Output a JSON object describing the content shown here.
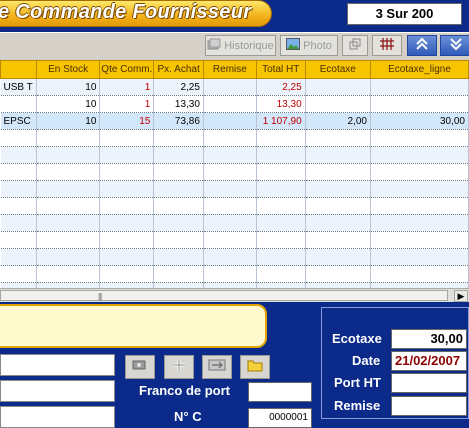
{
  "window": {
    "title": "e Commande Fournisseur",
    "record_counter": "3 Sur 200"
  },
  "toolbar": {
    "historique_label": "Historique",
    "photo_label": "Photo"
  },
  "colors": {
    "accent_gold": "#f2b11b",
    "navy_background": "#0b2a8a",
    "header_yellow": "#f7c400",
    "negative_red": "#c00000"
  },
  "grid": {
    "columns": [
      "",
      "En Stock",
      "Qte Comm.",
      "Px. Achat",
      "Remise",
      "Total HT",
      "Ecotaxe",
      "Ecotaxe_ligne"
    ],
    "rows": [
      [
        "USB T",
        "10",
        "1",
        "2,25",
        "",
        "2,25",
        "",
        ""
      ],
      [
        "",
        "10",
        "1",
        "13,30",
        "",
        "13,30",
        "",
        ""
      ],
      [
        "EPSC",
        "10",
        "15",
        "73,86",
        "",
        "1 107,90",
        "2,00",
        "30,00"
      ]
    ]
  },
  "footer": {
    "franco_label": "Franco de port",
    "no_label": "N° C",
    "no_value": "0000001",
    "ecotaxe_label": "Ecotaxe",
    "ecotaxe_value": "30,00",
    "date_label": "Date",
    "date_value": "21/02/2007",
    "port_label": "Port HT",
    "remise_label": "Remise"
  }
}
